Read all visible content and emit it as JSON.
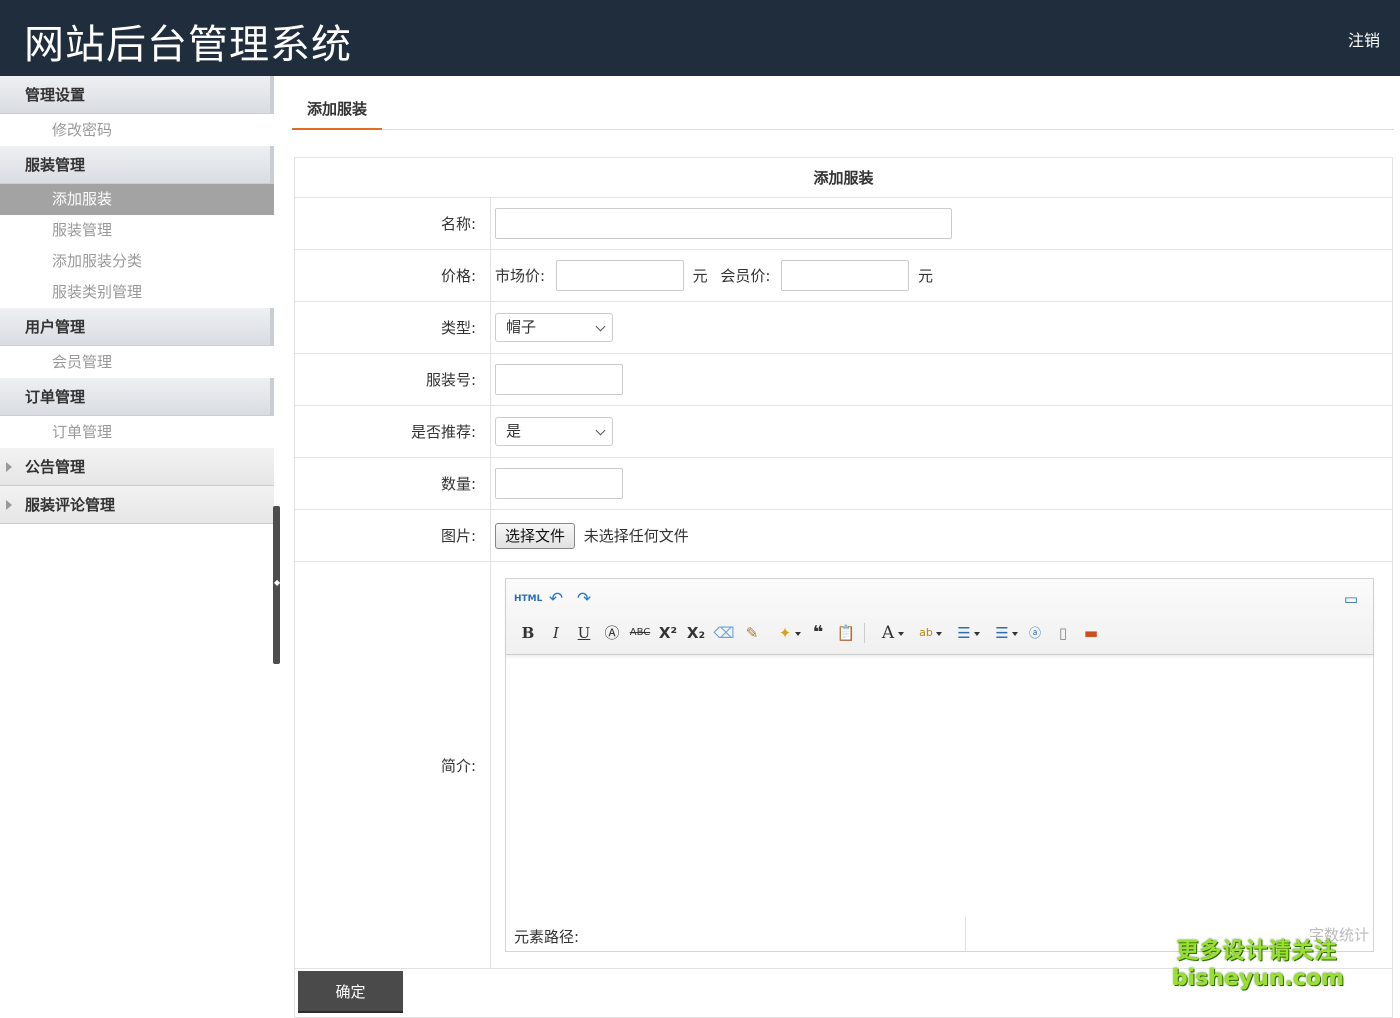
{
  "header": {
    "title": "网站后台管理系统",
    "logout": "注销"
  },
  "sidebar": {
    "groups": [
      {
        "label": "管理设置",
        "items": [
          "修改密码"
        ]
      },
      {
        "label": "服装管理",
        "items": [
          "添加服装",
          "服装管理",
          "添加服装分类",
          "服装类别管理"
        ],
        "active": "添加服装"
      },
      {
        "label": "用户管理",
        "items": [
          "会员管理"
        ]
      },
      {
        "label": "订单管理",
        "items": [
          "订单管理"
        ]
      },
      {
        "label": "公告管理",
        "items": []
      },
      {
        "label": "服装评论管理",
        "items": []
      }
    ]
  },
  "tab": {
    "label": "添加服装"
  },
  "form": {
    "caption": "添加服装",
    "name_label": "名称:",
    "name_value": "",
    "price_label": "价格:",
    "market_price_label": "市场价:",
    "member_price_label": "会员价:",
    "unit": "元",
    "type_label": "类型:",
    "type_value": "帽子",
    "code_label": "服装号:",
    "recommend_label": "是否推荐:",
    "recommend_value": "是",
    "qty_label": "数量:",
    "image_label": "图片:",
    "file_button": "选择文件",
    "file_status": "未选择任何文件",
    "intro_label": "简介:",
    "editor": {
      "path_label": "元素路径:",
      "count_label": "字数统计"
    },
    "submit": "确定"
  },
  "watermark": {
    "line1": "更多设计请关注",
    "line2": "bisheyun.com"
  },
  "colors": {
    "header_bg": "#1f2d3d",
    "tab_underline": "#e36b22",
    "active_item_bg": "#a3a3a3",
    "submit_bg": "#4a4a4a"
  }
}
